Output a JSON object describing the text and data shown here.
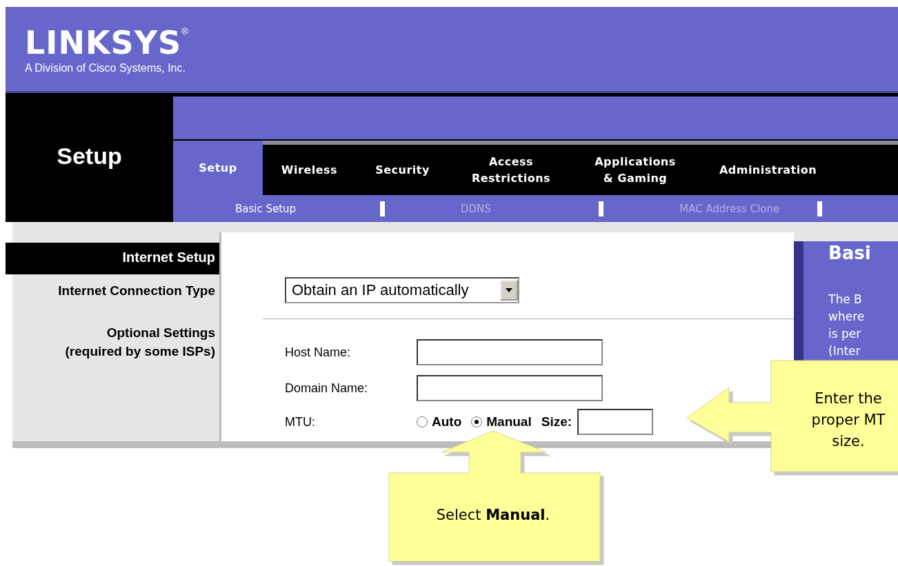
{
  "header": {
    "logo": "LINKSYS",
    "registered_mark": "®",
    "tagline": "A Division of Cisco Systems, Inc."
  },
  "section_title": "Setup",
  "tabs": [
    {
      "label": "Setup",
      "selected": true
    },
    {
      "label": "Wireless",
      "selected": false
    },
    {
      "label": "Security",
      "selected": false
    },
    {
      "label": "Access\nRestrictions",
      "selected": false
    },
    {
      "label": "Applications\n& Gaming",
      "selected": false
    },
    {
      "label": "Administration",
      "selected": false
    }
  ],
  "subtabs": [
    {
      "label": "Basic Setup",
      "selected": true
    },
    {
      "label": "DDNS",
      "selected": false
    },
    {
      "label": "MAC Address Clone",
      "selected": false
    }
  ],
  "sidebar": {
    "heading": "Internet Setup",
    "labels": [
      "Internet Connection Type",
      "Optional Settings\n(required by some ISPs)"
    ]
  },
  "connection_type": {
    "value": "Obtain an IP automatically"
  },
  "fields": [
    {
      "label": "Host Name:"
    },
    {
      "label": "Domain Name:"
    }
  ],
  "mtu": {
    "label": "MTU:",
    "options": [
      {
        "label": "Auto",
        "selected": false
      },
      {
        "label": "Manual",
        "selected": true
      }
    ],
    "size_label": "Size:"
  },
  "help_panel": {
    "title": "Basi",
    "lines": [
      "The B",
      "where",
      "is per",
      "(Inter"
    ]
  },
  "callouts": [
    {
      "kind": "up",
      "text": "Select **Manual**."
    },
    {
      "kind": "left",
      "text": "Enter the\nproper MT\nsize."
    }
  ]
}
